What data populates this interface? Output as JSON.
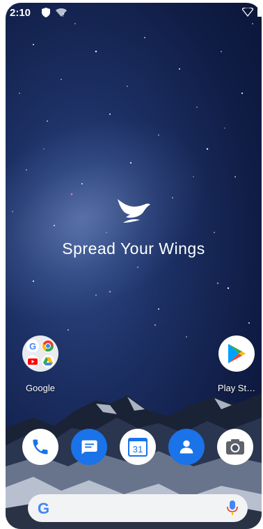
{
  "status_bar": {
    "time": "2:10"
  },
  "wallpaper": {
    "brand_text": "Spread Your Wings"
  },
  "home_apps": [
    {
      "label": "Google",
      "icon": "google-folder-icon"
    },
    {
      "label": "Play St…",
      "icon": "play-store-icon"
    }
  ],
  "dock": [
    {
      "icon": "phone-icon"
    },
    {
      "icon": "messages-icon"
    },
    {
      "icon": "calendar-icon",
      "text": "31"
    },
    {
      "icon": "contacts-icon"
    },
    {
      "icon": "camera-icon"
    }
  ],
  "search_bar": {
    "logo": "G",
    "icon": "google-logo-icon",
    "mic_icon": "microphone-icon"
  },
  "colors": {
    "blue": "#1a73e8",
    "red": "#ea4335",
    "yellow": "#fbbc04",
    "green": "#34a853"
  }
}
